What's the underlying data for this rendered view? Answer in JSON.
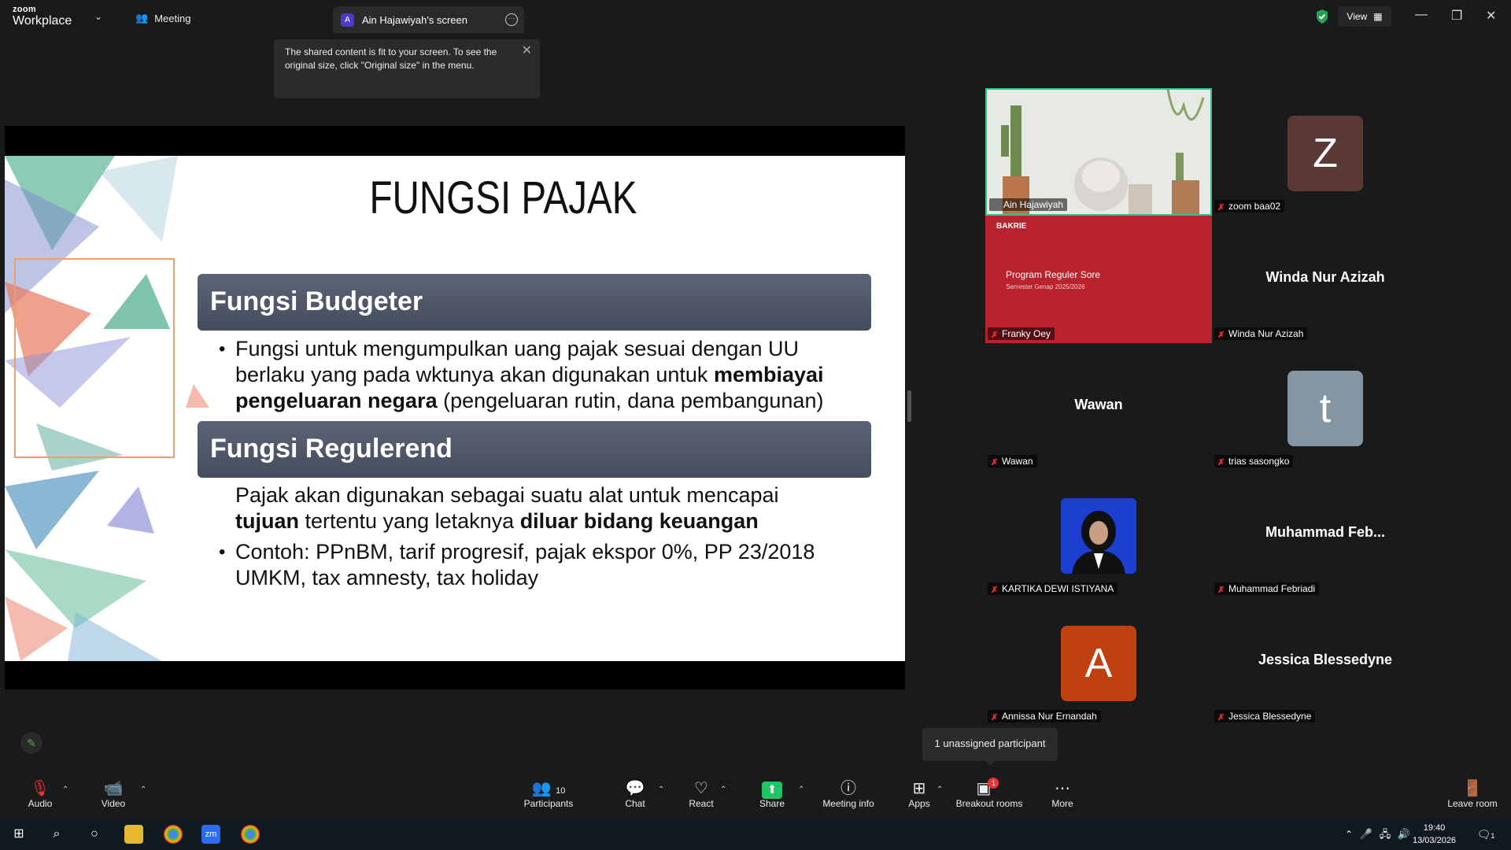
{
  "app": {
    "logo_small": "zoom",
    "logo_big": "Workplace",
    "meeting_tab": "Meeting",
    "screen_tab": "Ain Hajawiyah's screen",
    "screen_tab_avatar": "A",
    "view_label": "View"
  },
  "tooltip": {
    "text": "The shared content is fit to your screen. To see the original size, click \"Original size\" in the menu."
  },
  "slide": {
    "title": "FUNGSI PAJAK",
    "heading1": "Fungsi Budgeter",
    "b1_line1": "Fungsi untuk mengumpulkan uang pajak sesuai dengan UU",
    "b1_line2a": "berlaku yang pada wktunya akan digunakan untuk ",
    "b1_line2b": "membiayai",
    "b1_line3a": "pengeluaran negara",
    "b1_line3b": " (pengeluaran rutin, dana pembangunan)",
    "heading2": "Fungsi Regulerend",
    "p2_line1": "Pajak akan digunakan sebagai suatu alat untuk mencapai",
    "p2_line2a": "tujuan",
    "p2_line2b": " tertentu yang letaknya ",
    "p2_line2c": "diluar bidang keuangan",
    "b3_line1": "Contoh: PPnBM, tarif progresif, pajak ekspor 0%, PP 23/2018",
    "b3_line2": "UMKM, tax amnesty, tax holiday"
  },
  "participants": [
    {
      "name": "Ain Hajawiyah",
      "kind": "video"
    },
    {
      "name": "zoom baa02",
      "avatar": "Z",
      "color": "#5b3a35"
    },
    {
      "name": "Franky Oey",
      "kind": "slide",
      "slide_text": "Program Reguler Sore",
      "slide_sub": "Semester Genap 2025/2026",
      "slide_logo": "BAKRIE"
    },
    {
      "name": "Winda Nur Azizah",
      "display": "Winda Nur Azizah"
    },
    {
      "name": "Wawan",
      "display": "Wawan"
    },
    {
      "name": "trias sasongko",
      "avatar": "t",
      "color": "#8495a4"
    },
    {
      "name": "KARTIKA DEWI ISTIYANA",
      "kind": "photo"
    },
    {
      "name": "Muhammad Febriadi",
      "display": "Muhammad  Feb..."
    },
    {
      "name": "Annissa Nur Ernandah",
      "avatar": "A",
      "color": "#c0400f"
    },
    {
      "name": "Jessica Blessedyne",
      "display": "Jessica Blessedyne"
    }
  ],
  "unassigned": "1 unassigned participant",
  "toolbar": {
    "audio": "Audio",
    "video": "Video",
    "participants": "Participants",
    "participants_count": "10",
    "chat": "Chat",
    "react": "React",
    "share": "Share",
    "meeting_info": "Meeting info",
    "apps": "Apps",
    "breakout": "Breakout rooms",
    "breakout_badge": "1",
    "more": "More",
    "leave": "Leave room"
  },
  "taskbar": {
    "time": "19:40",
    "date": "13/03/2026",
    "notif": "1"
  }
}
